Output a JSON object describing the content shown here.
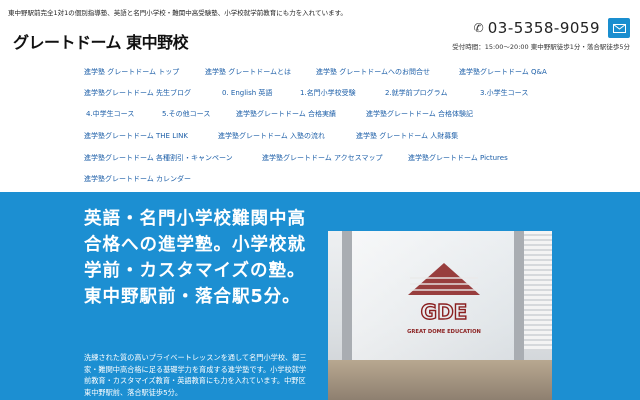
{
  "header": {
    "tagline": "東中野駅前完全1対1の個別指導塾、英語と名門小学校・難関中高受験塾、小学校就学前教育にも力を入れています。",
    "logo": "グレートドーム 東中野校",
    "phone": "03-5358-9059",
    "hours": "受付時間：15:00〜20:00  東中野駅徒歩1分・落合駅徒歩5分",
    "phone_icon": "phone-icon",
    "mail_icon": "mail-icon",
    "accent": "#1a8ecf"
  },
  "nav": {
    "items": [
      "進学塾 グレートドーム トップ",
      "進学塾 グレートドームとは",
      "進学塾 グレートドームへのお問合せ",
      "進学塾グレートドーム Q&A",
      "進学塾グレートドーム 先生ブログ",
      "0. English 英語",
      "1.名門小学校受験",
      "2.就学前プログラム",
      "3.小学生コース",
      "4.中学生コース",
      "5.その他コース",
      "進学塾グレートドーム 合格実績",
      "進学塾グレートドーム 合格体験記",
      "進学塾グレートドーム THE LINK",
      "進学塾グレートドーム 入塾の流れ",
      "進学塾 グレートドーム 人財募集",
      "進学塾グレートドーム 各種割引・キャンペーン",
      "進学塾グレートドーム アクセスマップ",
      "進学塾グレートドーム Pictures",
      "進学塾グレートドーム カレンダー"
    ],
    "link_color": "#1d5fa8"
  },
  "hero": {
    "headline": "英語・名門小学校難関中高合格への進学塾。小学校就学前・カスタマイズの塾。東中野駅前・落合駅5分。",
    "description": "洗練された質の高いプライベートレッスンを通して名門小学校、御三家・難関中高合格に足る基礎学力を育成する進学塾です。小学校就学前教育・カスタマイズ教育・英語教育にも力を入れています。中野区東中野駅前、落合駅徒歩5分。",
    "background": "#1c8fd2",
    "photo_sign_text": "GREAT DOME EDUCATION",
    "photo_sign_letters": "GDE"
  }
}
